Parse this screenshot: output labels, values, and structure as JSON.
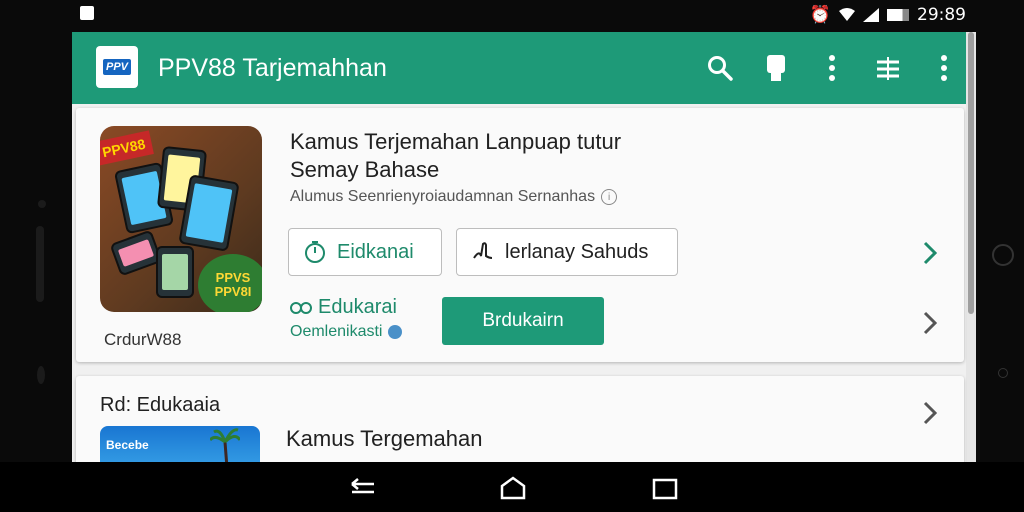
{
  "status": {
    "time": "29:89"
  },
  "appbar": {
    "logo_text": "PPV",
    "title": "PPV88 Tarjemahhan",
    "icons": [
      "search-icon",
      "bookmark-icon",
      "more-vert-icon",
      "filter-icon",
      "more-vert-icon"
    ]
  },
  "card": {
    "thumb_badge_top": "PPV88",
    "thumb_badge_bottom": "PPVS PPV8I",
    "thumb_caption": "CrdurW88",
    "title": "Kamus Terjemahan Lanpuap tutur Semay Bahase",
    "subtitle": "Alumus Seenrienyroiaudamnan Sernanhas",
    "outline_button_1": "Eidkanai",
    "outline_button_2": "lerlanay Sahuds",
    "edu_title": "Edukarai",
    "edu_sub": "Oemlenikasti",
    "primary_button": "Brdukairn"
  },
  "card2": {
    "label": "Rd: Edukaaia",
    "thumb_text": "Becebe",
    "title": "Kamus Tergemahan"
  },
  "colors": {
    "accent": "#1e9a78"
  }
}
